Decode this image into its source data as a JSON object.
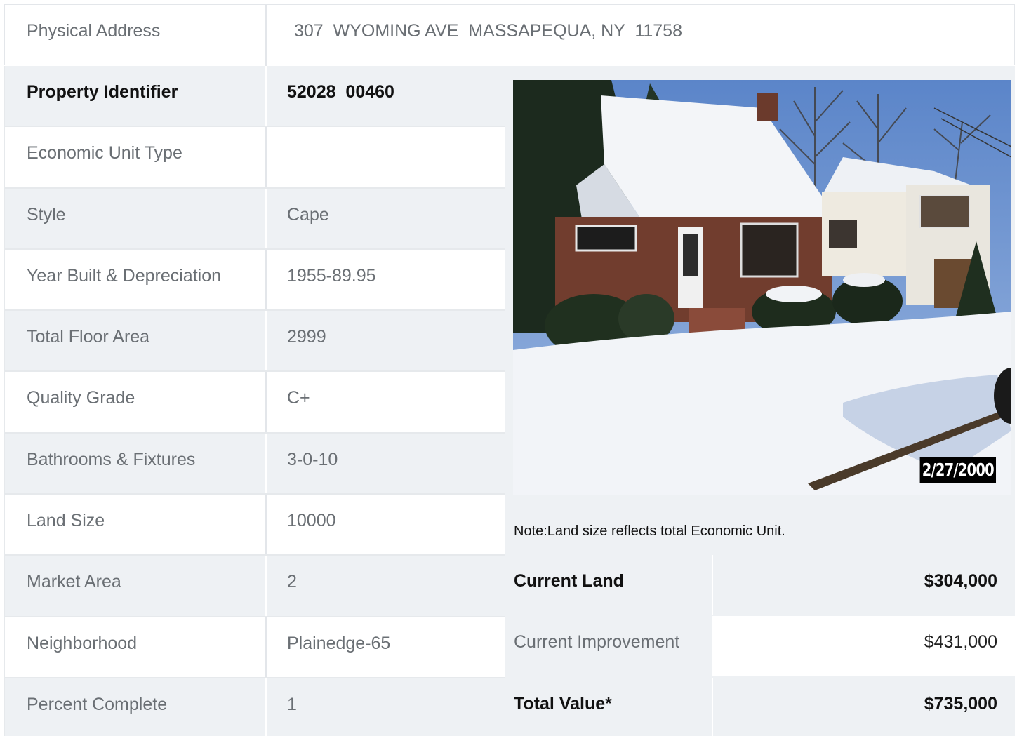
{
  "address": {
    "label": "Physical Address",
    "value": "307  WYOMING AVE  MASSAPEQUA, NY  11758"
  },
  "details": [
    {
      "label": "Property Identifier",
      "value": "52028  00460",
      "bold": true
    },
    {
      "label": "Economic Unit Type",
      "value": ""
    },
    {
      "label": "Style",
      "value": "Cape"
    },
    {
      "label": "Year Built & Depreciation",
      "value": "1955-89.95"
    },
    {
      "label": "Total Floor Area",
      "value": "2999"
    },
    {
      "label": "Quality Grade",
      "value": "C+"
    },
    {
      "label": "Bathrooms & Fixtures",
      "value": "3-0-10"
    },
    {
      "label": "Land Size",
      "value": "10000"
    },
    {
      "label": "Market Area",
      "value": "2"
    },
    {
      "label": "Neighborhood",
      "value": "Plainedge-65"
    },
    {
      "label": "Percent Complete",
      "value": "1"
    }
  ],
  "photo": {
    "date_stamp": "2/27/2000"
  },
  "note": "Note:Land size reflects total Economic Unit.",
  "values": [
    {
      "label": "Current Land",
      "value": "$304,000",
      "bold": true
    },
    {
      "label": "Current Improvement",
      "value": "$431,000",
      "bold": false
    },
    {
      "label": "Total Value*",
      "value": "$735,000",
      "bold": true
    }
  ]
}
